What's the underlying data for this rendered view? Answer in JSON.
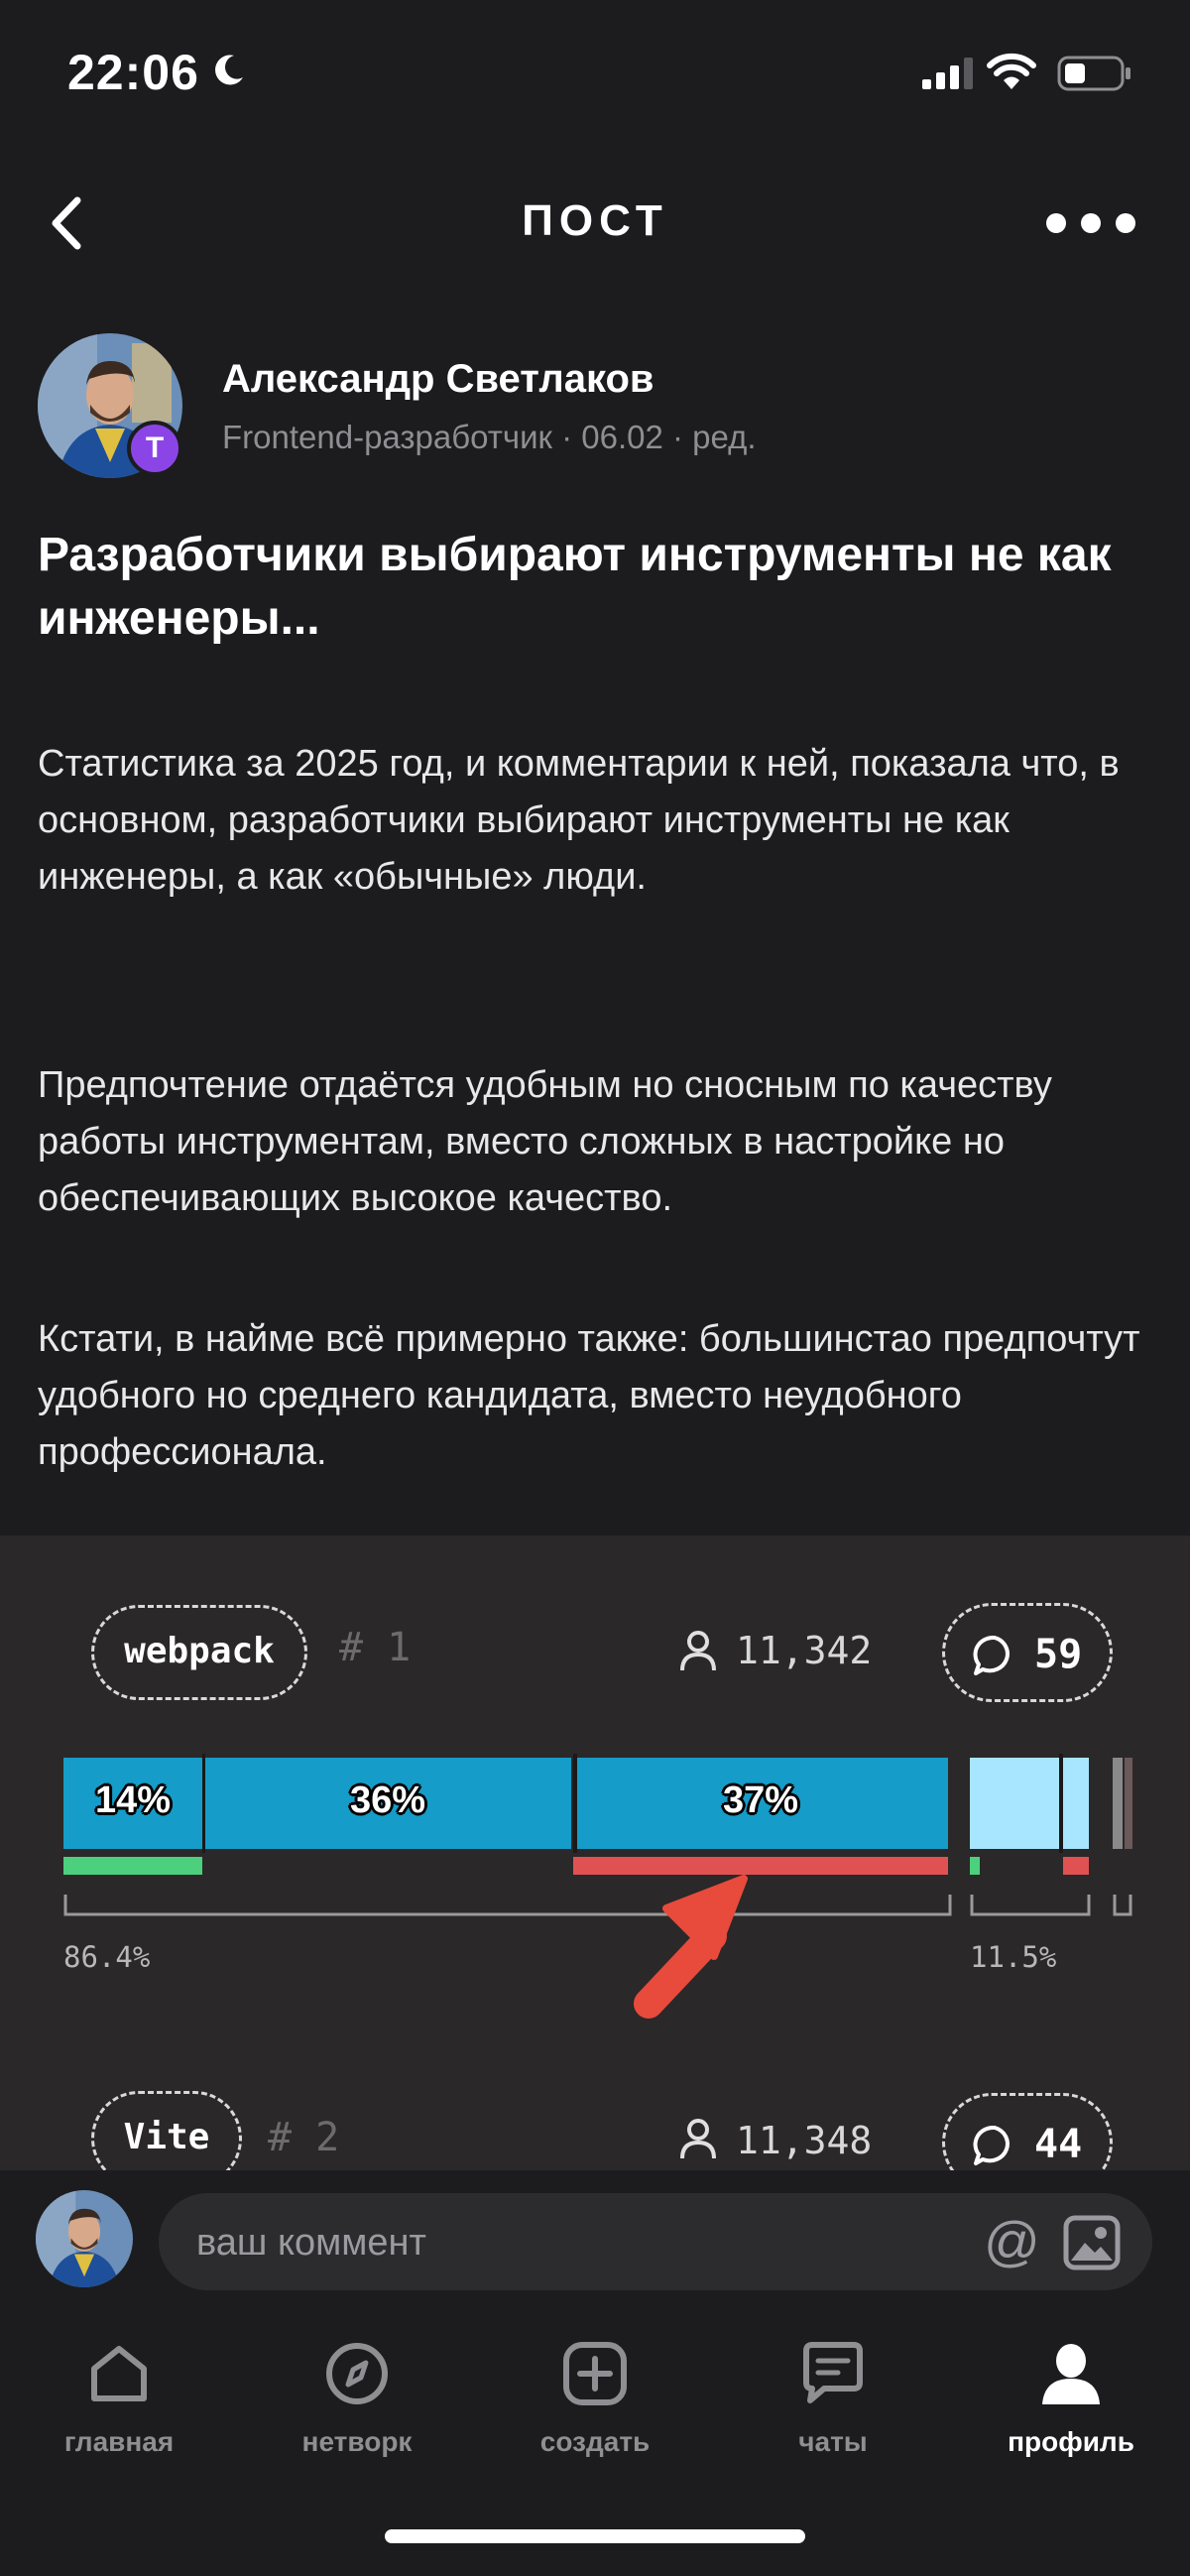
{
  "status": {
    "time": "22:06"
  },
  "header": {
    "title": "ПОСТ"
  },
  "author": {
    "name": "Александр Светлаков",
    "badge_letter": "Т",
    "meta": "Frontend-разработчик · 06.02 · ред."
  },
  "post": {
    "title": "Разработчики выбирают инструменты не как инженеры...",
    "paragraphs": [
      "Статистика за 2025 год, и комментарии к ней, показала что, в основном, разработчики выбирают инструменты не как инженеры, а как «обычные» люди.",
      "Предпочтение отдаётся удобным но сносным по качеству работы инструментам, вместо сложных в настройке но обеспечивающих высокое качество.",
      "Кстати, в найме всё примерно также: большинстао предпочтут удобного но среднего кандидата, вместо неудобного профессионала."
    ]
  },
  "embed": {
    "tools": [
      {
        "name": "webpack",
        "rank": "# 1",
        "users": "11,342",
        "comments": "59"
      },
      {
        "name": "Vite",
        "rank": "# 2",
        "users": "11,348",
        "comments": "44"
      }
    ],
    "bar_labels": [
      "14%",
      "36%",
      "37%"
    ],
    "left_percent": "86.4%",
    "right_percent": "11.5%"
  },
  "comment": {
    "placeholder": "ваш коммент"
  },
  "tabs": [
    {
      "label": "главная",
      "icon": "home-icon"
    },
    {
      "label": "нетворк",
      "icon": "compass-icon"
    },
    {
      "label": "создать",
      "icon": "plus-square-icon"
    },
    {
      "label": "чаты",
      "icon": "chat-icon"
    },
    {
      "label": "профиль",
      "icon": "profile-icon"
    }
  ],
  "colors": {
    "background": "#1c1c1e",
    "badge": "#8b45e6",
    "bar_blue": "#169cc8",
    "bar_light": "#a8e6ff",
    "green": "#4cd07d",
    "red": "#e05252",
    "arrow": "#e84a3c"
  }
}
